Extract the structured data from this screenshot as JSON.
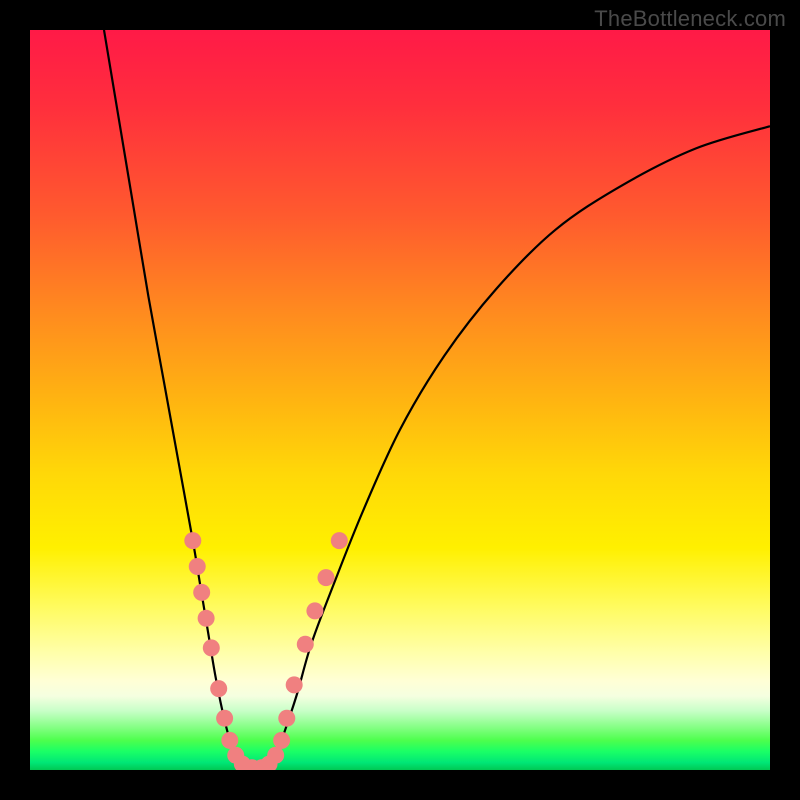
{
  "watermark": "TheBottleneck.com",
  "chart_data": {
    "type": "line",
    "title": "",
    "xlabel": "",
    "ylabel": "",
    "xlim": [
      0,
      100
    ],
    "ylim": [
      0,
      100
    ],
    "series": [
      {
        "name": "curve-left",
        "x": [
          10,
          12,
          14,
          16,
          18,
          20,
          22,
          23,
          24,
          25,
          26,
          27,
          28
        ],
        "y": [
          100,
          88,
          76,
          64,
          53,
          42,
          31,
          25,
          19,
          13,
          8,
          4,
          1
        ]
      },
      {
        "name": "curve-right",
        "x": [
          33,
          34,
          36,
          38,
          41,
          45,
          50,
          56,
          63,
          71,
          80,
          90,
          100
        ],
        "y": [
          1,
          4,
          10,
          17,
          25,
          35,
          46,
          56,
          65,
          73,
          79,
          84,
          87
        ]
      },
      {
        "name": "valley-floor",
        "x": [
          28,
          29,
          30,
          31,
          32,
          33
        ],
        "y": [
          1,
          0.3,
          0.1,
          0.1,
          0.3,
          1
        ]
      }
    ],
    "markers": {
      "name": "highlighted-points",
      "color": "#f08080",
      "points_xy": [
        [
          22.0,
          31.0
        ],
        [
          22.6,
          27.5
        ],
        [
          23.2,
          24.0
        ],
        [
          23.8,
          20.5
        ],
        [
          24.5,
          16.5
        ],
        [
          25.5,
          11.0
        ],
        [
          26.3,
          7.0
        ],
        [
          27.0,
          4.0
        ],
        [
          27.8,
          2.0
        ],
        [
          28.7,
          0.8
        ],
        [
          30.0,
          0.3
        ],
        [
          31.3,
          0.3
        ],
        [
          32.3,
          0.8
        ],
        [
          33.2,
          2.0
        ],
        [
          34.0,
          4.0
        ],
        [
          34.7,
          7.0
        ],
        [
          35.7,
          11.5
        ],
        [
          37.2,
          17.0
        ],
        [
          38.5,
          21.5
        ],
        [
          40.0,
          26.0
        ],
        [
          41.8,
          31.0
        ]
      ]
    }
  }
}
